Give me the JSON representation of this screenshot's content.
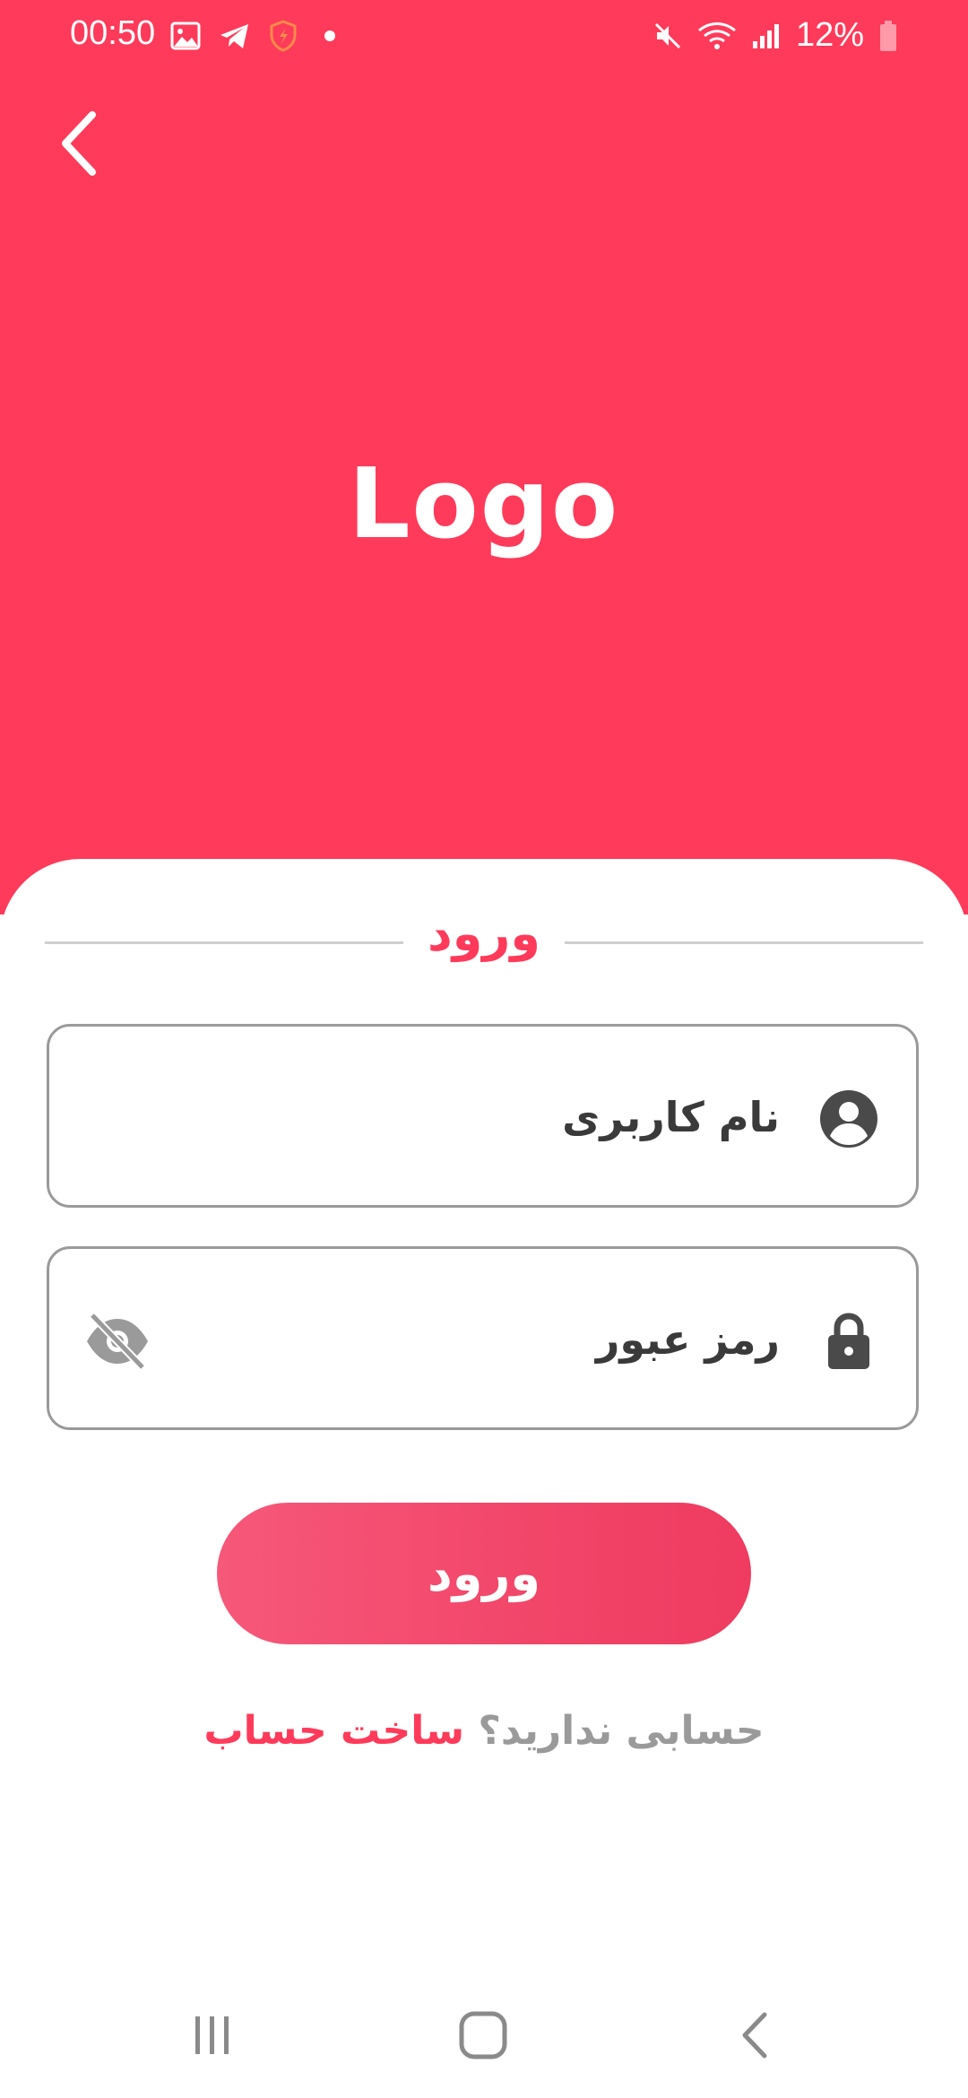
{
  "status_bar": {
    "time": "00:50",
    "battery": "12%",
    "left_icons": [
      "gallery-icon",
      "telegram-icon",
      "shield-icon",
      "dot-icon"
    ],
    "right_icons": [
      "mute-icon",
      "wifi-icon",
      "signal-icon",
      "battery-icon"
    ]
  },
  "header": {
    "back_icon": "chevron-left-icon",
    "logo": "Logo",
    "background_color": "#FF3A5A"
  },
  "form": {
    "title": "ورود",
    "username_placeholder": "نام کاربری",
    "password_placeholder": "رمز عبور",
    "username_icon": "account-circle-icon",
    "password_icon": "lock-icon",
    "toggle_icon": "eye-off-icon",
    "submit_label": "ورود"
  },
  "register": {
    "question": "حسابی ندارید؟",
    "link": "ساخت حساب"
  },
  "nav": {
    "items": [
      "recents-icon",
      "home-icon",
      "back-icon"
    ]
  },
  "colors": {
    "accent": "#FF3A5A",
    "muted_text": "#9a9a9a"
  }
}
